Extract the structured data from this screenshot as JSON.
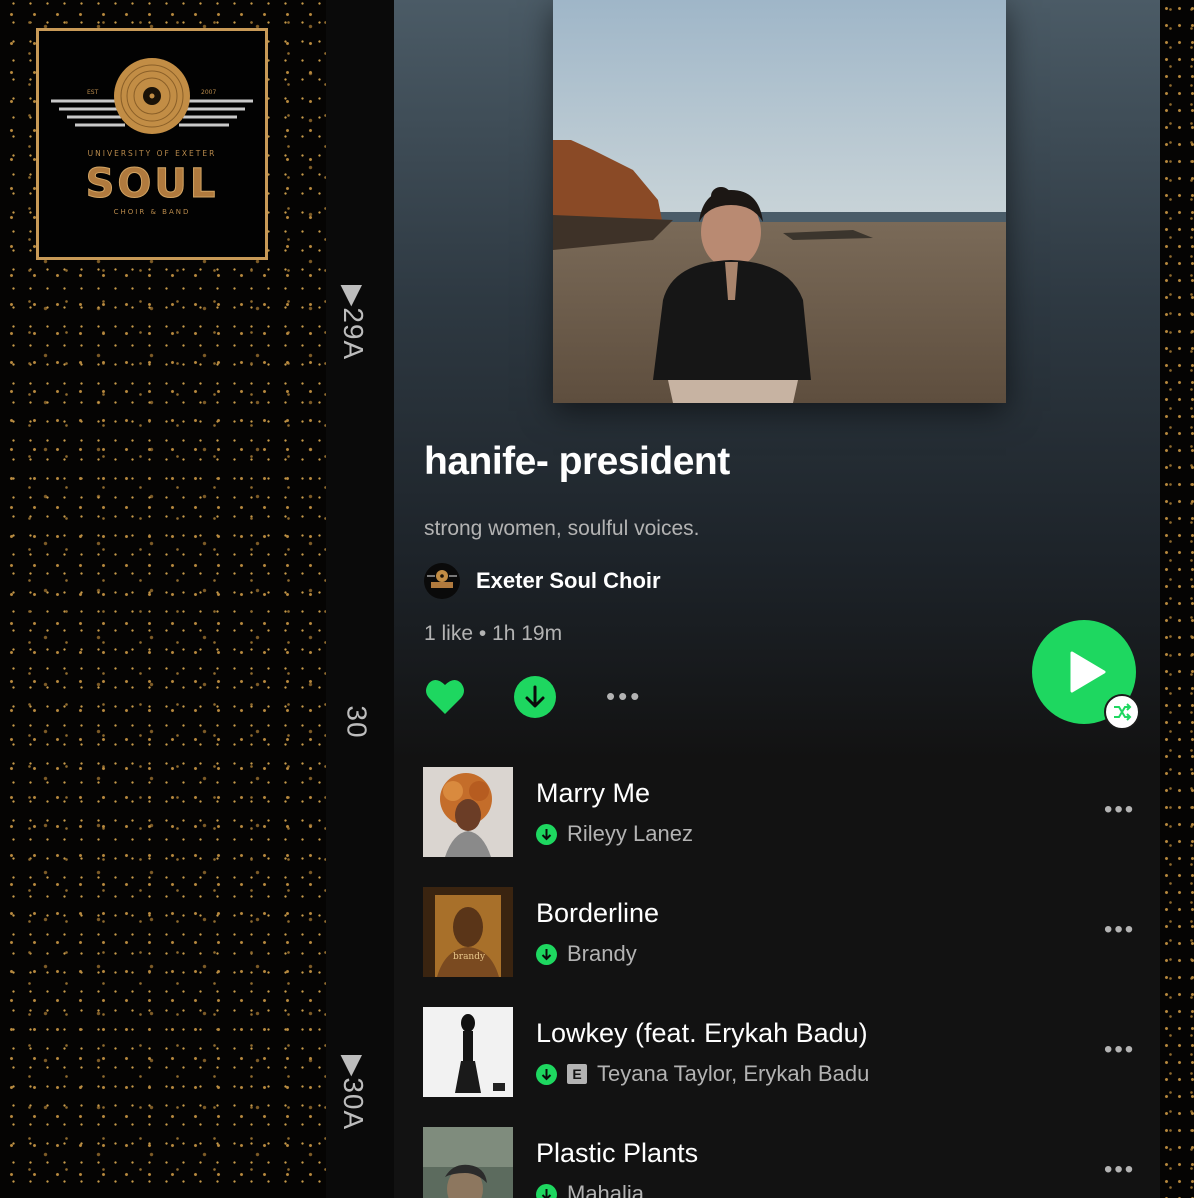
{
  "logo": {
    "est_left": "EST",
    "est_right": "2007",
    "university": "UNIVERSITY OF EXETER",
    "wordmark": "SOUL",
    "subtitle": "CHOIR & BAND"
  },
  "film_strip": {
    "marks": [
      "▶29A",
      "30",
      "▶30A"
    ]
  },
  "playlist": {
    "title": "hanife- president",
    "description": "strong women, soulful voices.",
    "owner": "Exeter Soul Choir",
    "meta": "1 like • 1h 19m",
    "more_label": "•••"
  },
  "tracks": [
    {
      "title": "Marry Me",
      "artist": "Rileyy Lanez",
      "explicit": false,
      "downloaded": true,
      "more": "•••"
    },
    {
      "title": "Borderline",
      "artist": "Brandy",
      "explicit": false,
      "downloaded": true,
      "more": "•••"
    },
    {
      "title": "Lowkey (feat. Erykah Badu)",
      "artist": "Teyana Taylor, Erykah Badu",
      "explicit": true,
      "explicit_label": "E",
      "downloaded": true,
      "more": "•••"
    },
    {
      "title": "Plastic Plants",
      "artist": "Mahalia",
      "explicit": false,
      "downloaded": true,
      "more": "•••"
    }
  ],
  "icons": {
    "heart": "heart-icon",
    "download": "download-icon",
    "play": "play-icon",
    "shuffle": "shuffle-icon"
  },
  "colors": {
    "spotify_green": "#1ed760",
    "gold": "#c89a57",
    "text_secondary": "#b3b3b3"
  }
}
